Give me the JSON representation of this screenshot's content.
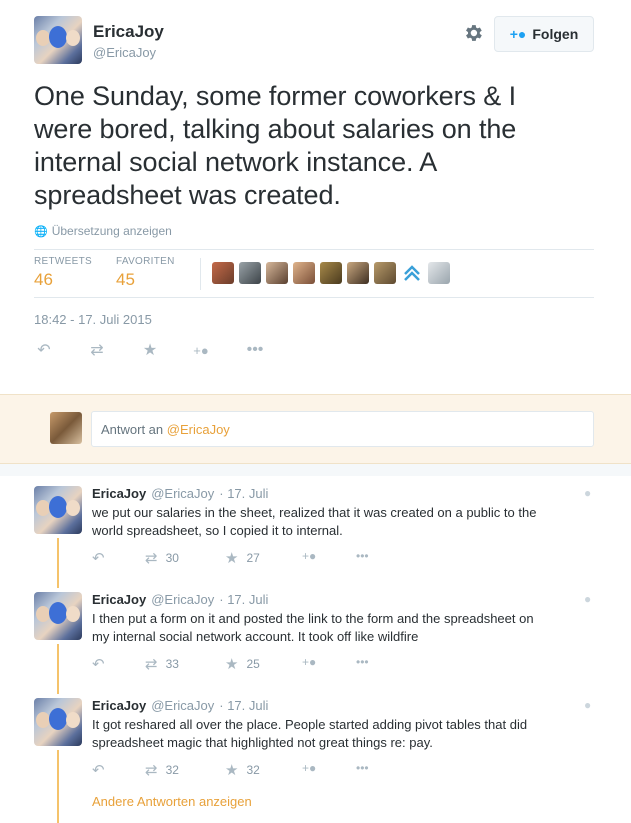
{
  "header": {
    "name": "EricaJoy",
    "handle": "@EricaJoy",
    "follow_label": "Folgen"
  },
  "tweet": {
    "text_lines": [
      "One Sunday, some former coworkers & I",
      "were bored, talking about salaries on the",
      "internal social network instance. A",
      "spreadsheet was created."
    ],
    "translate_label": "Übersetzung anzeigen",
    "retweets_label": "RETWEETS",
    "retweets_count": "46",
    "favorites_label": "FAVORITEN",
    "favorites_count": "45",
    "timestamp": "18:42 - 17. Juli 2015"
  },
  "reply_box": {
    "placeholder_prefix": "Antwort an ",
    "placeholder_handle": "@EricaJoy"
  },
  "replies": [
    {
      "name": "EricaJoy",
      "handle": "@EricaJoy",
      "date": "· 17. Juli",
      "lines": [
        "we put our salaries in the sheet, realized that it was created on a public to the",
        "world spreadsheet, so I copied it to internal."
      ],
      "retweets": "30",
      "favorites": "27"
    },
    {
      "name": "EricaJoy",
      "handle": "@EricaJoy",
      "date": "· 17. Juli",
      "lines": [
        "I then put a form on it and posted the link to the form and the spreadsheet on",
        "my internal social network account. It took off like wildfire"
      ],
      "retweets": "33",
      "favorites": "25"
    },
    {
      "name": "EricaJoy",
      "handle": "@EricaJoy",
      "date": "· 17. Juli",
      "lines": [
        "It got reshared all over the place. People started adding pivot tables that did",
        "spreadsheet magic that highlighted not great things re: pay."
      ],
      "retweets": "32",
      "favorites": "32"
    }
  ],
  "show_more_label": "Andere Antworten anzeigen",
  "colors": {
    "accent": "#e8a13a",
    "muted": "#8899a6",
    "thread_line": "#f5c36b",
    "reply_bg": "#fcf4e8"
  },
  "icons": {
    "settings": "gear-icon",
    "follow": "add-user-icon",
    "translate": "globe-icon",
    "reply": "reply-icon",
    "retweet": "retweet-icon",
    "favorite": "star-icon",
    "more": "more-icon"
  }
}
